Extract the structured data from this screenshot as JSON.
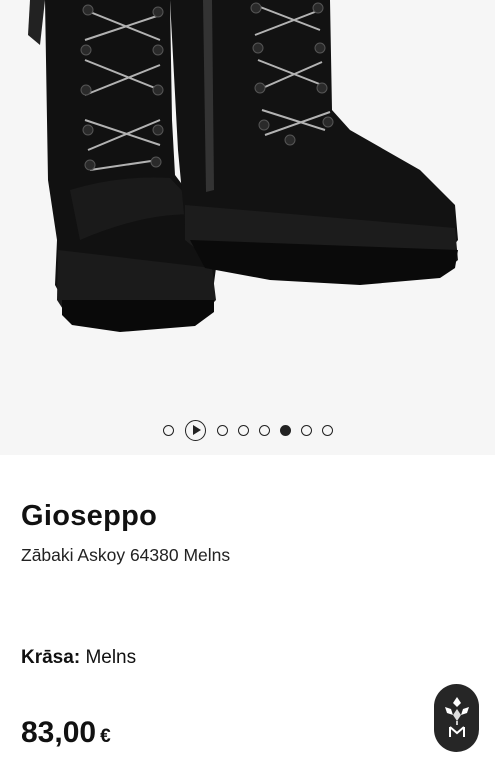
{
  "gallery": {
    "image_alt": "Gioseppo Zābaki Askoy 64380 Melns",
    "slides": [
      {
        "type": "image",
        "active": false
      },
      {
        "type": "video",
        "active": false
      },
      {
        "type": "image",
        "active": false
      },
      {
        "type": "image",
        "active": false
      },
      {
        "type": "image",
        "active": false
      },
      {
        "type": "image",
        "active": true
      },
      {
        "type": "image",
        "active": false
      },
      {
        "type": "image",
        "active": false
      }
    ]
  },
  "product": {
    "brand": "Gioseppo",
    "name": "Zābaki Askoy 64380 Melns",
    "color_label": "Krāsa:",
    "color_value": "Melns",
    "price_value": "83,00",
    "price_currency": "€"
  },
  "fab": {
    "icon": "assistant-logo-icon"
  },
  "colors": {
    "background": "#ffffff",
    "gallery_bg": "#f6f6f6",
    "text": "#111111",
    "fab_bg": "#262626"
  }
}
